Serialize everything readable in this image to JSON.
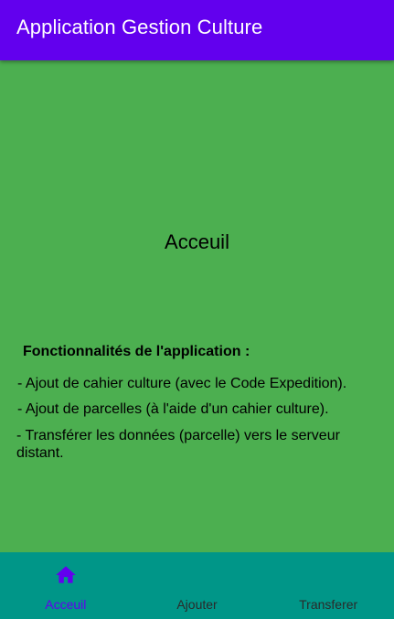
{
  "appbar": {
    "title": "Application Gestion Culture",
    "color": "#6200EE"
  },
  "main": {
    "background": "#4CAF50",
    "page_title": "Acceuil",
    "features_heading": "Fonctionnalités de l'application :",
    "features": [
      "- Ajout de cahier culture (avec le Code Expedition).",
      "- Ajout de parcelles (à l'aide d'un cahier culture).",
      "- Transférer les données (parcelle) vers le serveur distant."
    ]
  },
  "bottom_nav": {
    "background": "#009688",
    "active_color": "#6200EE",
    "items": [
      {
        "label": "Acceuil",
        "icon": "home-icon",
        "active": true
      },
      {
        "label": "Ajouter",
        "active": false
      },
      {
        "label": "Transferer",
        "active": false
      }
    ]
  }
}
